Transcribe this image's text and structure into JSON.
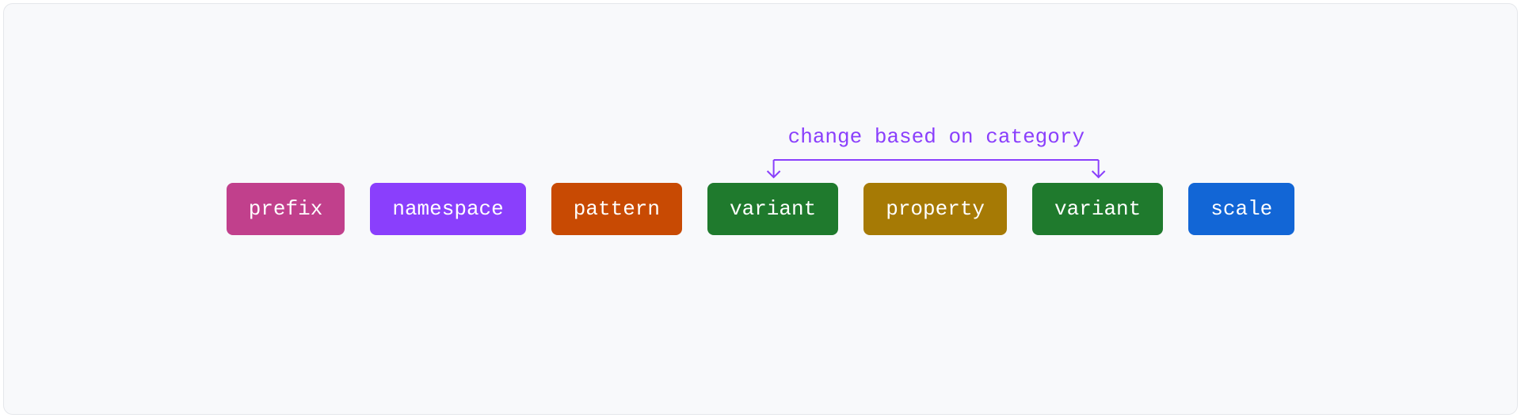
{
  "annotation": {
    "label": "change based on category",
    "color": "#8a3ffc"
  },
  "tokens": [
    {
      "id": "prefix",
      "label": "prefix",
      "bg": "#c1408c"
    },
    {
      "id": "namespace",
      "label": "namespace",
      "bg": "#8a3ffc"
    },
    {
      "id": "pattern",
      "label": "pattern",
      "bg": "#c84a03"
    },
    {
      "id": "variant-1",
      "label": "variant",
      "bg": "#1f7a2d"
    },
    {
      "id": "property",
      "label": "property",
      "bg": "#a67a05"
    },
    {
      "id": "variant-2",
      "label": "variant",
      "bg": "#1f7a2d"
    },
    {
      "id": "scale",
      "label": "scale",
      "bg": "#1266d6"
    }
  ]
}
